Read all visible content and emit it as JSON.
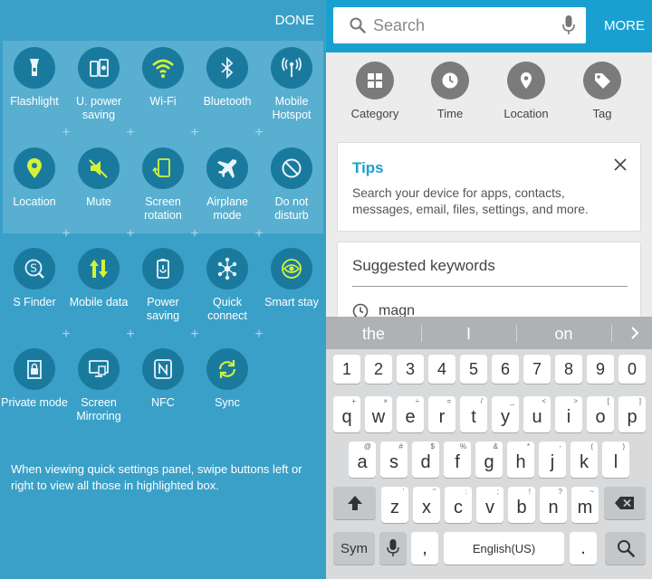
{
  "left_panel": {
    "done_label": "DONE",
    "tiles": [
      {
        "label": "Flashlight",
        "icon": "flashlight-icon"
      },
      {
        "label": "U. power saving",
        "icon": "ultra-power-saving-icon"
      },
      {
        "label": "Wi-Fi",
        "icon": "wifi-icon"
      },
      {
        "label": "Bluetooth",
        "icon": "bluetooth-icon"
      },
      {
        "label": "Mobile Hotspot",
        "icon": "hotspot-icon"
      },
      {
        "label": "Location",
        "icon": "location-pin-icon"
      },
      {
        "label": "Mute",
        "icon": "mute-icon"
      },
      {
        "label": "Screen rotation",
        "icon": "screen-rotation-icon"
      },
      {
        "label": "Airplane mode",
        "icon": "airplane-icon"
      },
      {
        "label": "Do not disturb",
        "icon": "do-not-disturb-icon"
      },
      {
        "label": "S Finder",
        "icon": "s-finder-icon"
      },
      {
        "label": "Mobile data",
        "icon": "mobile-data-icon"
      },
      {
        "label": "Power saving",
        "icon": "power-saving-icon"
      },
      {
        "label": "Quick connect",
        "icon": "quick-connect-icon"
      },
      {
        "label": "Smart stay",
        "icon": "smart-stay-icon"
      },
      {
        "label": "Private mode",
        "icon": "private-mode-icon"
      },
      {
        "label": "Screen Mirroring",
        "icon": "screen-mirroring-icon"
      },
      {
        "label": "NFC",
        "icon": "nfc-icon"
      },
      {
        "label": "Sync",
        "icon": "sync-icon"
      }
    ],
    "hint_text": "When viewing quick settings panel, swipe buttons left or right to view all those in highlighted box."
  },
  "search": {
    "placeholder": "Search",
    "more_label": "MORE",
    "filters": [
      {
        "label": "Category",
        "icon": "category-grid-icon"
      },
      {
        "label": "Time",
        "icon": "clock-icon"
      },
      {
        "label": "Location",
        "icon": "location-pin-icon"
      },
      {
        "label": "Tag",
        "icon": "tag-icon"
      }
    ],
    "tips": {
      "title": "Tips",
      "body": "Search your device for apps, contacts, messages, email, files, settings, and more."
    },
    "suggested": {
      "title": "Suggested keywords",
      "keyword": "magn"
    }
  },
  "keyboard": {
    "predictions": [
      "the",
      "I",
      "on"
    ],
    "numbers": [
      "1",
      "2",
      "3",
      "4",
      "5",
      "6",
      "7",
      "8",
      "9",
      "0"
    ],
    "row1": [
      [
        "q",
        "+"
      ],
      [
        "w",
        "×"
      ],
      [
        "e",
        "÷"
      ],
      [
        "r",
        "="
      ],
      [
        "t",
        "/"
      ],
      [
        "y",
        "_"
      ],
      [
        "u",
        "<"
      ],
      [
        "i",
        ">"
      ],
      [
        "o",
        "["
      ],
      [
        "p",
        "]"
      ]
    ],
    "row2": [
      [
        "a",
        "@"
      ],
      [
        "s",
        "#"
      ],
      [
        "d",
        "$"
      ],
      [
        "f",
        "%"
      ],
      [
        "g",
        "&"
      ],
      [
        "h",
        "*"
      ],
      [
        "j",
        "-"
      ],
      [
        "k",
        "("
      ],
      [
        "l",
        ")"
      ]
    ],
    "row3": [
      [
        "z",
        "'"
      ],
      [
        "x",
        "\""
      ],
      [
        "c",
        ":"
      ],
      [
        "v",
        ";"
      ],
      [
        "b",
        "!"
      ],
      [
        "n",
        "?"
      ],
      [
        "m",
        "~"
      ]
    ],
    "sym_label": "Sym",
    "comma": ",",
    "space_label": "English(US)",
    "period": "."
  },
  "colors": {
    "panel_bg": "#3aa0c8",
    "tile_circle": "#1a7a9e",
    "wifi_active": "#d4f23a",
    "accent_blue": "#1aa0d0"
  }
}
